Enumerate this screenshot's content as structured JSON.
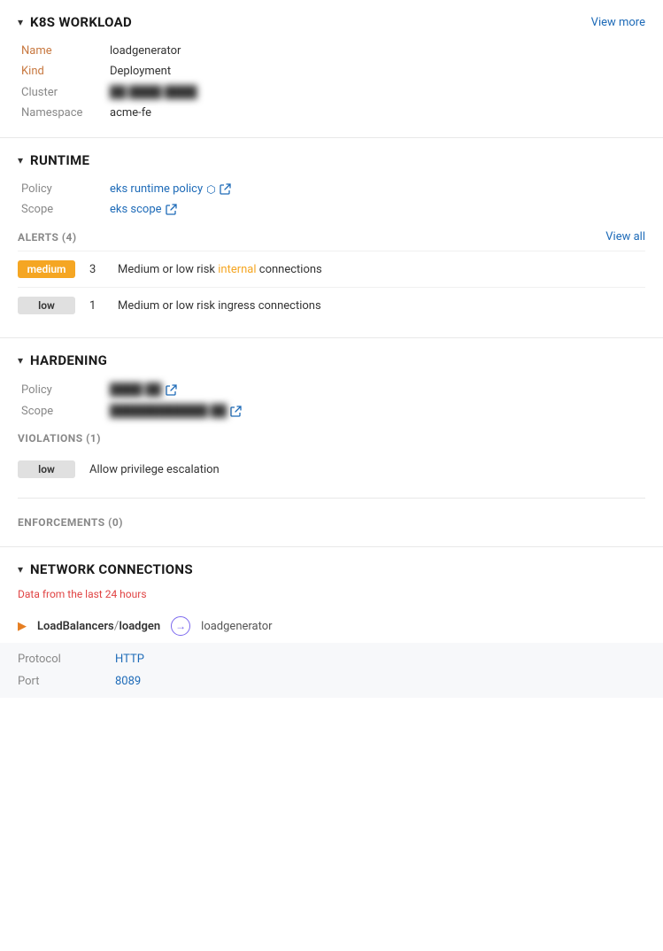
{
  "k8s_workload": {
    "section_title": "K8S WORKLOAD",
    "view_more_label": "View more",
    "chevron": "▾",
    "fields": [
      {
        "label": "Name",
        "value": "loadgenerator",
        "blurred": false,
        "link": false,
        "label_color": "orange"
      },
      {
        "label": "Kind",
        "value": "Deployment",
        "blurred": false,
        "link": false,
        "label_color": "orange"
      },
      {
        "label": "Cluster",
        "value": "██ ████ ████",
        "blurred": true,
        "link": false,
        "label_color": "gray"
      },
      {
        "label": "Namespace",
        "value": "acme-fe",
        "blurred": false,
        "link": false,
        "label_color": "gray"
      }
    ]
  },
  "runtime": {
    "section_title": "RUNTIME",
    "chevron": "▾",
    "policy_label": "Policy",
    "policy_value": "eks runtime policy",
    "scope_label": "Scope",
    "scope_value": "eks scope",
    "alerts_title": "ALERTS (4)",
    "view_all_label": "View all",
    "alerts": [
      {
        "badge": "medium",
        "count": "3",
        "text": "Medium or low risk internal connections",
        "highlight_word": "internal"
      },
      {
        "badge": "low",
        "count": "1",
        "text": "Medium or low risk ingress connections",
        "highlight_word": ""
      }
    ]
  },
  "hardening": {
    "section_title": "HARDENING",
    "chevron": "▾",
    "policy_label": "Policy",
    "policy_value": "████ ██",
    "scope_label": "Scope",
    "scope_value": "████████████ ██",
    "violations_title": "VIOLATIONS (1)",
    "violations": [
      {
        "badge": "low",
        "text": "Allow privilege escalation"
      }
    ],
    "enforcements_title": "ENFORCEMENTS (0)"
  },
  "network_connections": {
    "section_title": "NETWORK CONNECTIONS",
    "subtitle": "Data from the last 24 hours",
    "chevron": "▾",
    "connection_label": "LoadBalancers",
    "connection_slash": "/",
    "connection_name": "loadgen",
    "arrow_symbol": "→",
    "target": "loadgenerator",
    "details": [
      {
        "label": "Protocol",
        "value": "HTTP"
      },
      {
        "label": "Port",
        "value": "8089"
      }
    ]
  }
}
